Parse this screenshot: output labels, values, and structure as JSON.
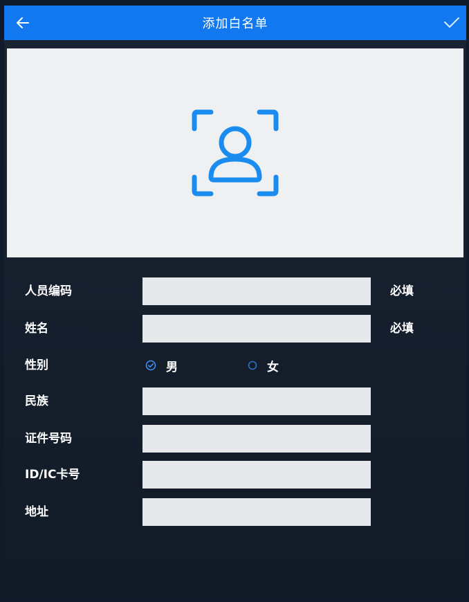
{
  "header": {
    "title": "添加白名单",
    "back_icon": "arrow-left-icon",
    "confirm_icon": "check-icon"
  },
  "preview": {
    "icon": "face-capture-icon",
    "accent_color": "#1a8cf0"
  },
  "form": {
    "fields": [
      {
        "label": "人员编码",
        "value": "",
        "note": "必填"
      },
      {
        "label": "姓名",
        "value": "",
        "note": "必填"
      },
      {
        "label": "性别"
      },
      {
        "label": "民族",
        "value": ""
      },
      {
        "label": "证件号码",
        "value": ""
      },
      {
        "label": "ID/IC卡号",
        "value": ""
      },
      {
        "label": "地址",
        "value": ""
      }
    ],
    "gender": {
      "options": [
        {
          "label": "男",
          "selected": true
        },
        {
          "label": "女",
          "selected": false
        }
      ]
    }
  },
  "colors": {
    "header_bg": "#1278f0",
    "background": "#111a26",
    "input_bg": "#e6e8eb"
  }
}
